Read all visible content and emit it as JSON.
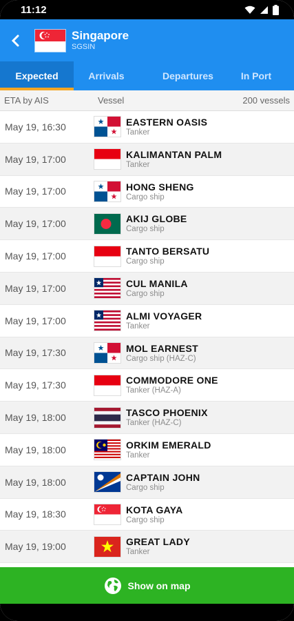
{
  "status_bar": {
    "time": "11:12"
  },
  "header": {
    "title": "Singapore",
    "code": "SGSIN"
  },
  "tabs": [
    {
      "label": "Expected",
      "active": true
    },
    {
      "label": "Arrivals",
      "active": false
    },
    {
      "label": "Departures",
      "active": false
    },
    {
      "label": "In Port",
      "active": false
    }
  ],
  "columns": {
    "eta": "ETA by AIS",
    "vessel": "Vessel",
    "count": "200 vessels"
  },
  "vessels": [
    {
      "eta": "May 19, 16:30",
      "name": "EASTERN OASIS",
      "type": "Tanker",
      "flag": "panama"
    },
    {
      "eta": "May 19, 17:00",
      "name": "KALIMANTAN PALM",
      "type": "Tanker",
      "flag": "indonesia"
    },
    {
      "eta": "May 19, 17:00",
      "name": "HONG SHENG",
      "type": "Cargo ship",
      "flag": "panama"
    },
    {
      "eta": "May 19, 17:00",
      "name": "AKIJ GLOBE",
      "type": "Cargo ship",
      "flag": "bangladesh"
    },
    {
      "eta": "May 19, 17:00",
      "name": "TANTO BERSATU",
      "type": "Cargo ship",
      "flag": "indonesia"
    },
    {
      "eta": "May 19, 17:00",
      "name": "CUL MANILA",
      "type": "Cargo ship",
      "flag": "liberia"
    },
    {
      "eta": "May 19, 17:00",
      "name": "ALMI VOYAGER",
      "type": "Tanker",
      "flag": "liberia"
    },
    {
      "eta": "May 19, 17:30",
      "name": "MOL EARNEST",
      "type": "Cargo ship (HAZ-C)",
      "flag": "panama"
    },
    {
      "eta": "May 19, 17:30",
      "name": "COMMODORE ONE",
      "type": "Tanker (HAZ-A)",
      "flag": "indonesia"
    },
    {
      "eta": "May 19, 18:00",
      "name": "TASCO PHOENIX",
      "type": "Tanker (HAZ-C)",
      "flag": "thailand"
    },
    {
      "eta": "May 19, 18:00",
      "name": "ORKIM EMERALD",
      "type": "Tanker",
      "flag": "malaysia"
    },
    {
      "eta": "May 19, 18:00",
      "name": "CAPTAIN JOHN",
      "type": "Cargo ship",
      "flag": "marshall-islands"
    },
    {
      "eta": "May 19, 18:30",
      "name": "KOTA GAYA",
      "type": "Cargo ship",
      "flag": "singapore"
    },
    {
      "eta": "May 19, 19:00",
      "name": "GREAT LADY",
      "type": "Tanker",
      "flag": "vietnam"
    }
  ],
  "map_button": {
    "label": "Show on map"
  },
  "colors": {
    "primary": "#1f8ef0",
    "tab_indicator": "#f5a623",
    "map_button": "#2db323"
  }
}
